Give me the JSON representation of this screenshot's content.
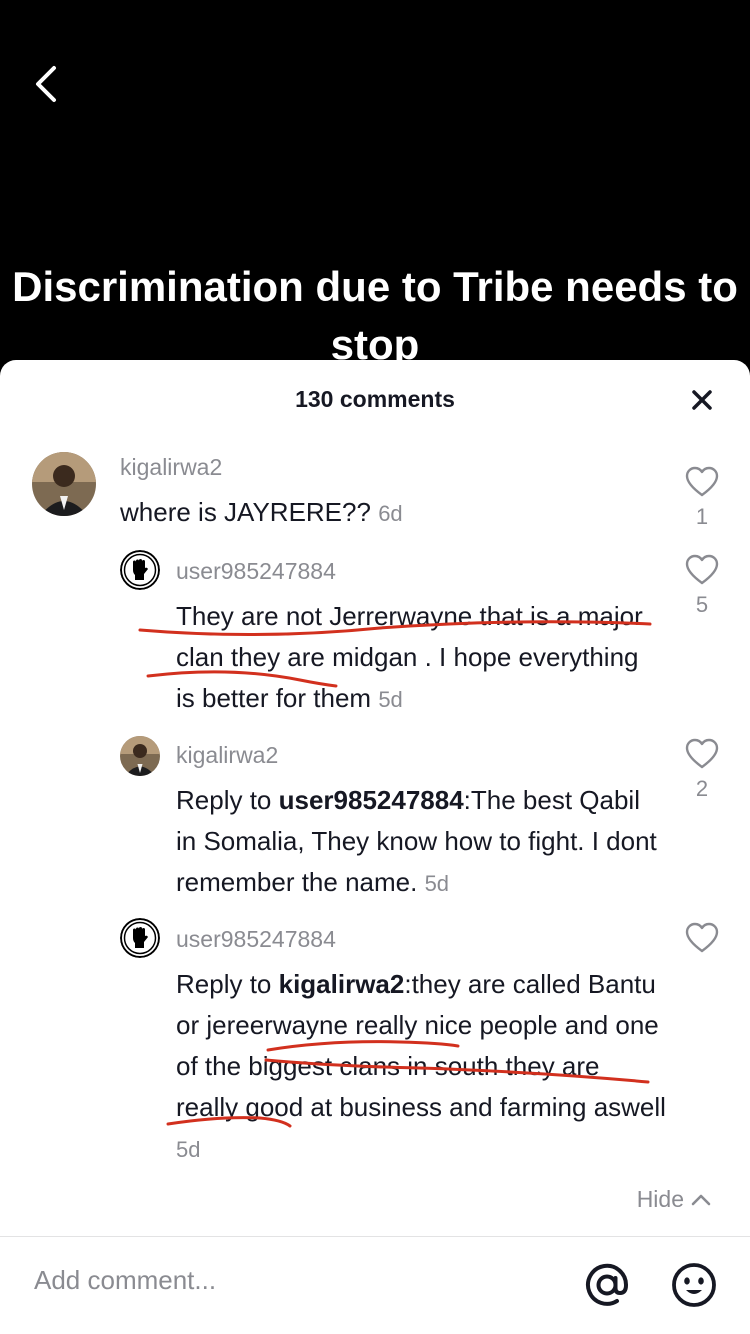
{
  "video": {
    "caption": "Discrimination due to Tribe needs to stop"
  },
  "sheet": {
    "title": "130 comments"
  },
  "comments": [
    {
      "username": "kigalirwa2",
      "text": "where is JAYRERE??",
      "time": "6d",
      "likes": "1"
    },
    {
      "username": "user985247884",
      "text": "They are not Jerrerwayne that is a major clan they are midgan . I hope everything is better for them",
      "time": "5d",
      "likes": "5"
    },
    {
      "username": "kigalirwa2",
      "reply_prefix": "Reply to ",
      "reply_to": "user985247884",
      "text": ":The best Qabil in Somalia, They know how to fight. I dont remember the name.",
      "time": "5d",
      "likes": "2"
    },
    {
      "username": "user985247884",
      "reply_prefix": "Reply to ",
      "reply_to": "kigalirwa2",
      "text": ":they are called Bantu or jereerwayne really nice people and one of the biggest clans in south they are really good at business and farming aswell",
      "time": "5d",
      "likes": ""
    }
  ],
  "hide_label": "Hide",
  "composer": {
    "placeholder": "Add comment..."
  },
  "icons": {
    "back": "chevron-left-icon",
    "close": "close-icon",
    "like": "heart-outline-icon",
    "mention": "at-sign-icon",
    "emoji": "smiley-icon",
    "hide": "chevron-up-icon"
  },
  "colors": {
    "annotation_red": "#d2301e",
    "muted_text": "#8a8b91"
  }
}
